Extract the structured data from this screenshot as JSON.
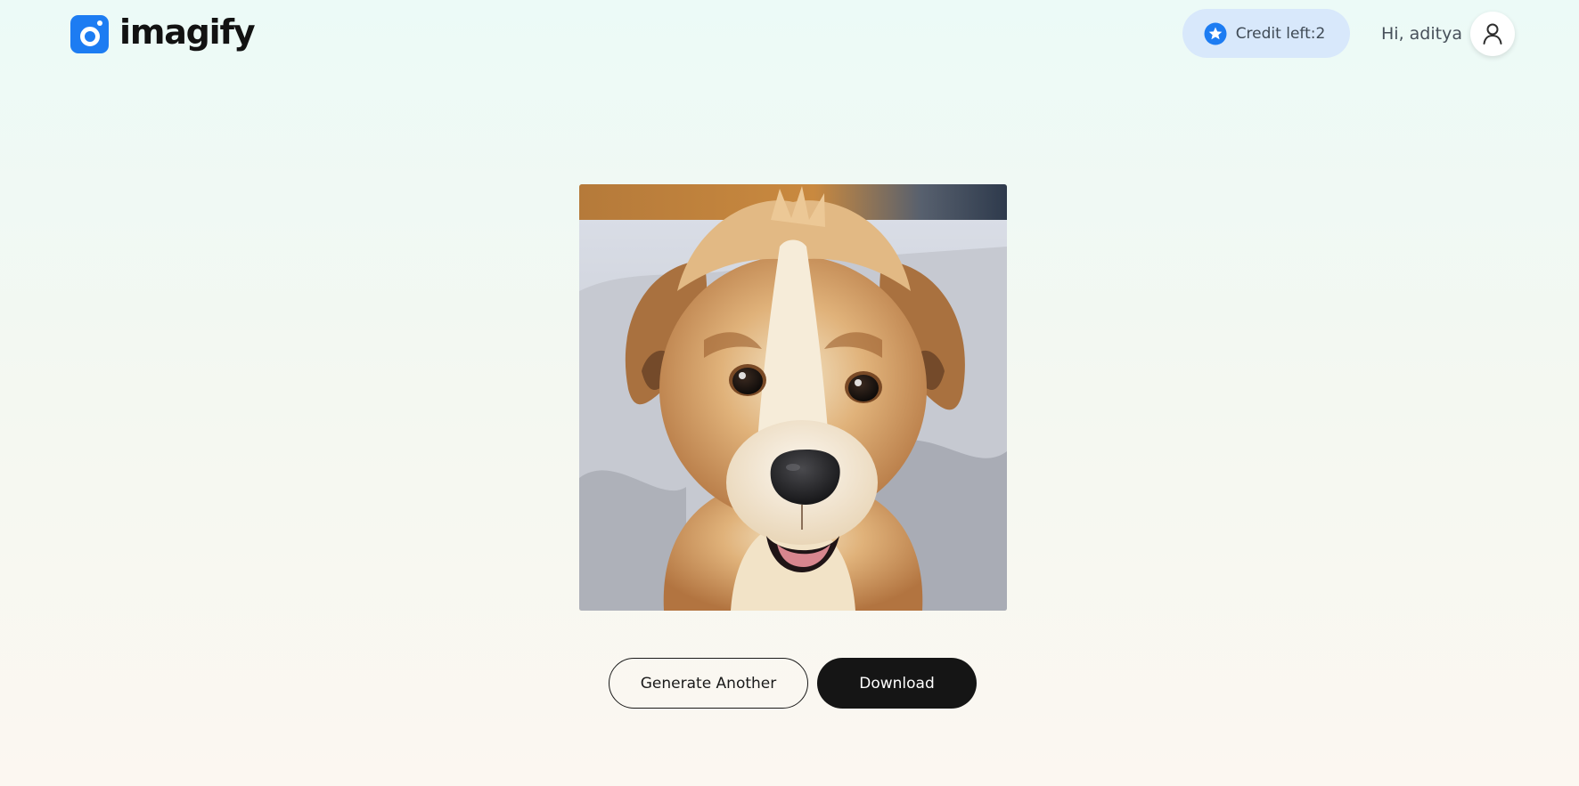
{
  "header": {
    "brand": "imagify",
    "credits_label": "Credit left:2",
    "greeting": "Hi, aditya"
  },
  "result": {
    "image_alt": "Generated image of a fluffy golden puppy"
  },
  "actions": {
    "generate_another_label": "Generate Another",
    "download_label": "Download"
  },
  "colors": {
    "brand_blue": "#1d7cf2",
    "credit_pill_bg": "#d8e8fb",
    "download_bg": "#151515"
  },
  "icons": {
    "logo": "imagify-logo-icon",
    "credits": "star-badge-icon",
    "avatar": "user-icon"
  }
}
